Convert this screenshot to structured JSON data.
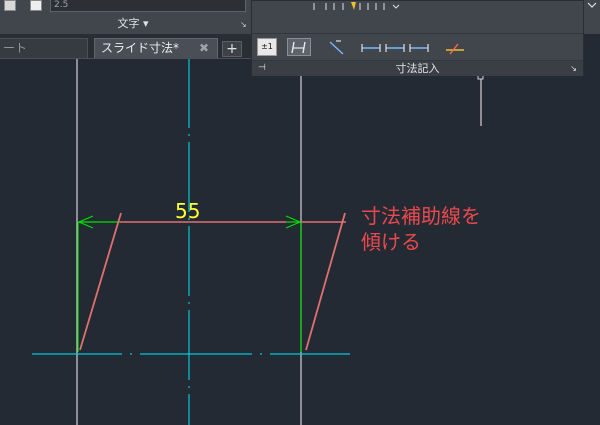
{
  "ribbon_left": {
    "text_style_value": "2.5",
    "panel_title": "文字 ▾"
  },
  "tabs": [
    {
      "label": "ートスタ",
      "display": "ート"
    },
    {
      "label": "スライド寸法*",
      "close": "✖"
    }
  ],
  "tab_add": "+",
  "dim_panel": {
    "label_toggle": "±1",
    "panel_title": "寸法記入",
    "pin_icon": "⊣"
  },
  "dimension": {
    "value": "55"
  },
  "annotation": {
    "line1": "寸法補助線を",
    "line2": "傾ける"
  },
  "colors": {
    "background": "#232a33",
    "centerline": "#00c8d7",
    "dimension_line": "#00e000",
    "extension_line": "#e07070",
    "dimension_text": "#ffff33",
    "annotation": "#e9494d"
  }
}
